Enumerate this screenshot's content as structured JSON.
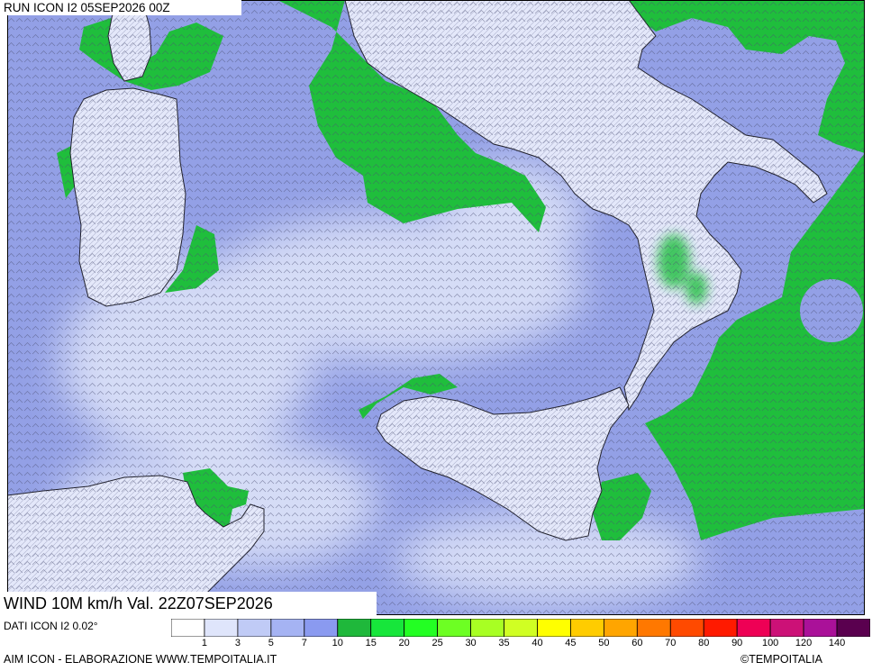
{
  "header": {
    "run_label": "RUN ICON I2 05SEP2026 00Z"
  },
  "map": {
    "valid_label": "WIND 10M km/h Val. 22Z07SEP2026"
  },
  "footer": {
    "data_source": "DATI ICON I2 0.02°",
    "credit": "AIM ICON - ELABORAZIONE WWW.TEMPOITALIA.IT",
    "copyright": "©TEMPOITALIA"
  },
  "legend": {
    "unit": "km/h",
    "ticks": [
      "1",
      "3",
      "5",
      "7",
      "10",
      "15",
      "20",
      "25",
      "30",
      "35",
      "40",
      "45",
      "50",
      "60",
      "70",
      "80",
      "90",
      "100",
      "120",
      "140"
    ],
    "colors": [
      "#ffffff",
      "#dfe5fb",
      "#c0cbf6",
      "#a5b3f3",
      "#8a9af0",
      "#1fb83b",
      "#17e63b",
      "#23ff23",
      "#6dff23",
      "#a8ff23",
      "#d0ff23",
      "#ffff00",
      "#ffcc00",
      "#ffa500",
      "#ff7800",
      "#ff4a00",
      "#ff1a00",
      "#ee0055",
      "#cc1177",
      "#aa1199",
      "#5a004f"
    ]
  },
  "colors": {
    "sea_calm": "#c5cdf1",
    "sea_base": "#93a0e6",
    "land": "#e4e8fa",
    "green_zone": "#1fbe3c",
    "coast": "#1e1e28"
  }
}
